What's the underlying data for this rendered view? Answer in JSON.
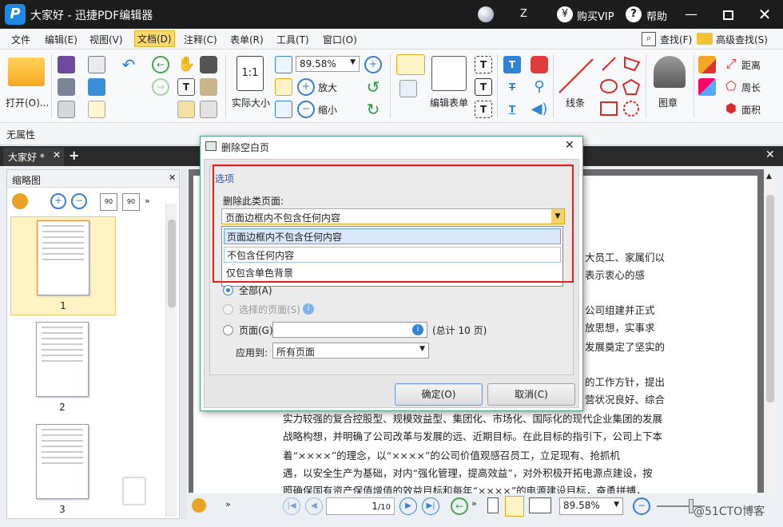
{
  "titlebar": {
    "doc_name": "大家好",
    "separator": "-",
    "app_name": "迅捷PDF编辑器",
    "user": "Z",
    "vip": "购买VIP",
    "help": "帮助"
  },
  "menu": [
    "文件",
    "编辑(E)",
    "视图(V)",
    "文档(D)",
    "注释(C)",
    "表单(R)",
    "工具(T)",
    "窗口(O)"
  ],
  "menu_right": {
    "find": "查找(F)",
    "adv_find": "高级查找(S)"
  },
  "ribbon": {
    "open": "打开(O)...",
    "actual_size": "实际大小",
    "zoom": "89.58%",
    "zoom_in": "放大",
    "zoom_out": "缩小",
    "edit_form": "编辑表单",
    "line": "线条",
    "stamp": "图章",
    "distance": "距离",
    "perimeter": "周长",
    "area": "面积"
  },
  "property_bar": "无属性",
  "tab": {
    "label": "大家好 *",
    "add": "+"
  },
  "sidebar": {
    "title": "缩略图",
    "pages": [
      "1",
      "2",
      "3"
    ]
  },
  "document_lines": [
    "大员工、家属们以",
    "表示衷心的感",
    "公司组建并正式",
    "放思想，实事求",
    "发展奠定了坚实的",
    "的工作方针，提出",
    "营状况良好、综合",
    "实力较强的复合控股型、规模效益型、集团化、市场化、国际化的现代企业集团的发展",
    "战略构想，并明确了公司改革与发展的远、近期目标。在此目标的指引下，公司上下本",
    "着“××××”的理念，以“××××”的公司价值观感召员工，立足现有、抢抓机",
    "遇，以安全生产为基础，对内“强化管理，提高效益”，对外积极开拓电源点建设，按",
    "照确保国有资产保值增值的效益目标和每年“××××”的电源建设目标，奋勇拼搏，"
  ],
  "statusbar": {
    "page": "1",
    "total": "/10",
    "zoom": "89.58%",
    "watermark": "@51CTO博客"
  },
  "dialog": {
    "title": "删除空白页",
    "group": "选项",
    "delete_label": "删除此类页面:",
    "selected": "页面边框内不包含任何内容",
    "options": [
      "页面边框内不包含任何内容",
      "不包含任何内容",
      "仅包含单色背景"
    ],
    "range_all": "全部(A)",
    "range_selected": "选择的页面(S)",
    "range_pages": "页面(G)",
    "pages_total": "(总计 10 页)",
    "apply_to_label": "应用到:",
    "apply_to_value": "所有页面",
    "ok": "确定(O)",
    "cancel": "取消(C)"
  }
}
